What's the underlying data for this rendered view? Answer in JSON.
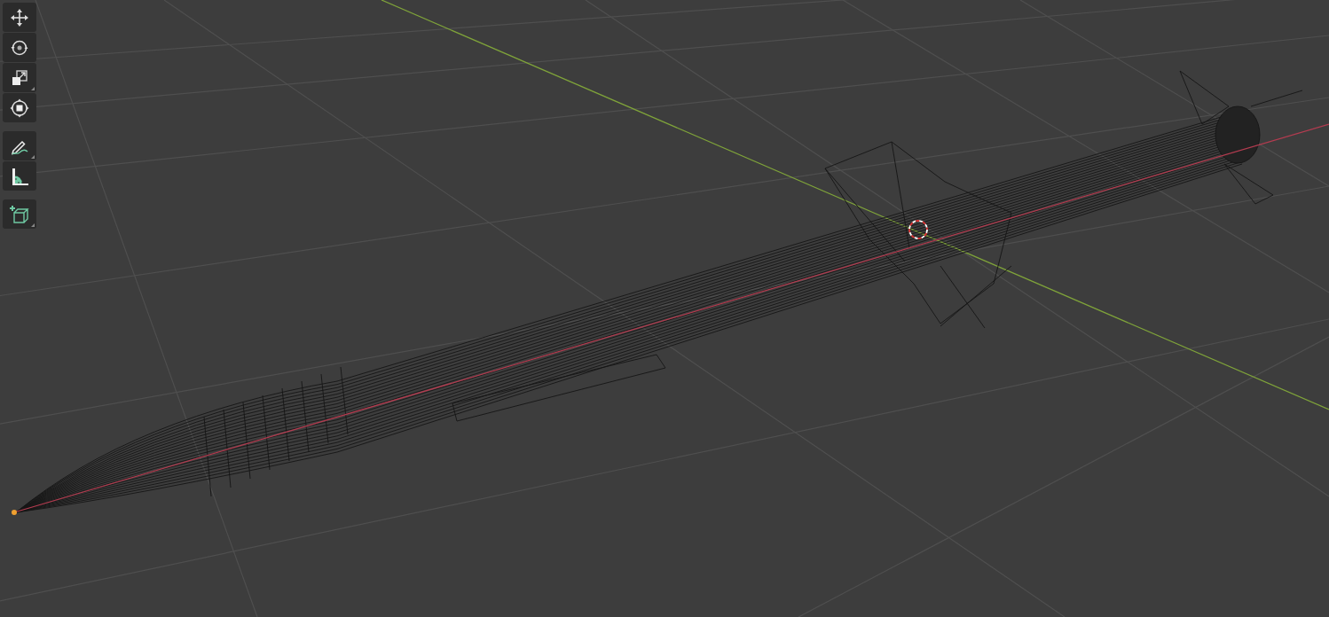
{
  "toolbar": {
    "groups": [
      {
        "tools": [
          {
            "kind": "move",
            "submenu": false
          },
          {
            "kind": "rotate",
            "submenu": false
          },
          {
            "kind": "scale",
            "submenu": true
          },
          {
            "kind": "transform",
            "submenu": false
          }
        ]
      },
      {
        "tools": [
          {
            "kind": "annotate",
            "submenu": true
          },
          {
            "kind": "measure",
            "submenu": false
          }
        ]
      },
      {
        "tools": [
          {
            "kind": "add-cube",
            "submenu": true
          }
        ]
      }
    ]
  }
}
